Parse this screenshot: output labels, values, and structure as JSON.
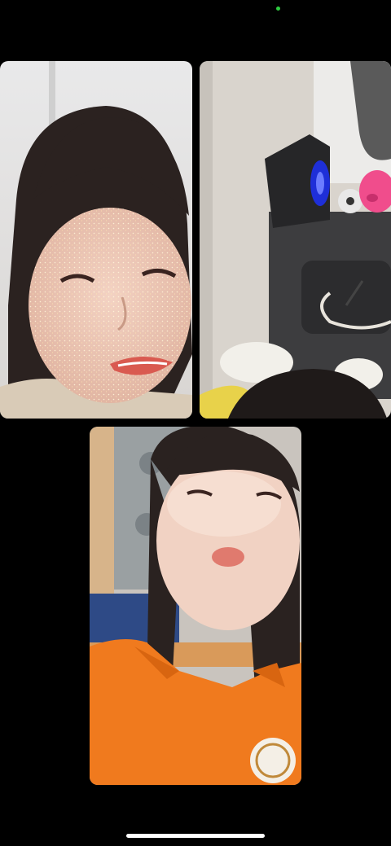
{
  "call": {
    "participants": [
      {
        "name_hint": "participant-1",
        "video": true
      },
      {
        "name_hint": "participant-2",
        "video": true
      },
      {
        "name_hint": "participant-3",
        "video": true
      }
    ],
    "status_indicator": "active"
  },
  "colors": {
    "background": "#000000",
    "status_dot": "#2ecc40",
    "home_indicator": "#ffffff"
  },
  "icons": [
    "camera-active-indicator-icon"
  ]
}
